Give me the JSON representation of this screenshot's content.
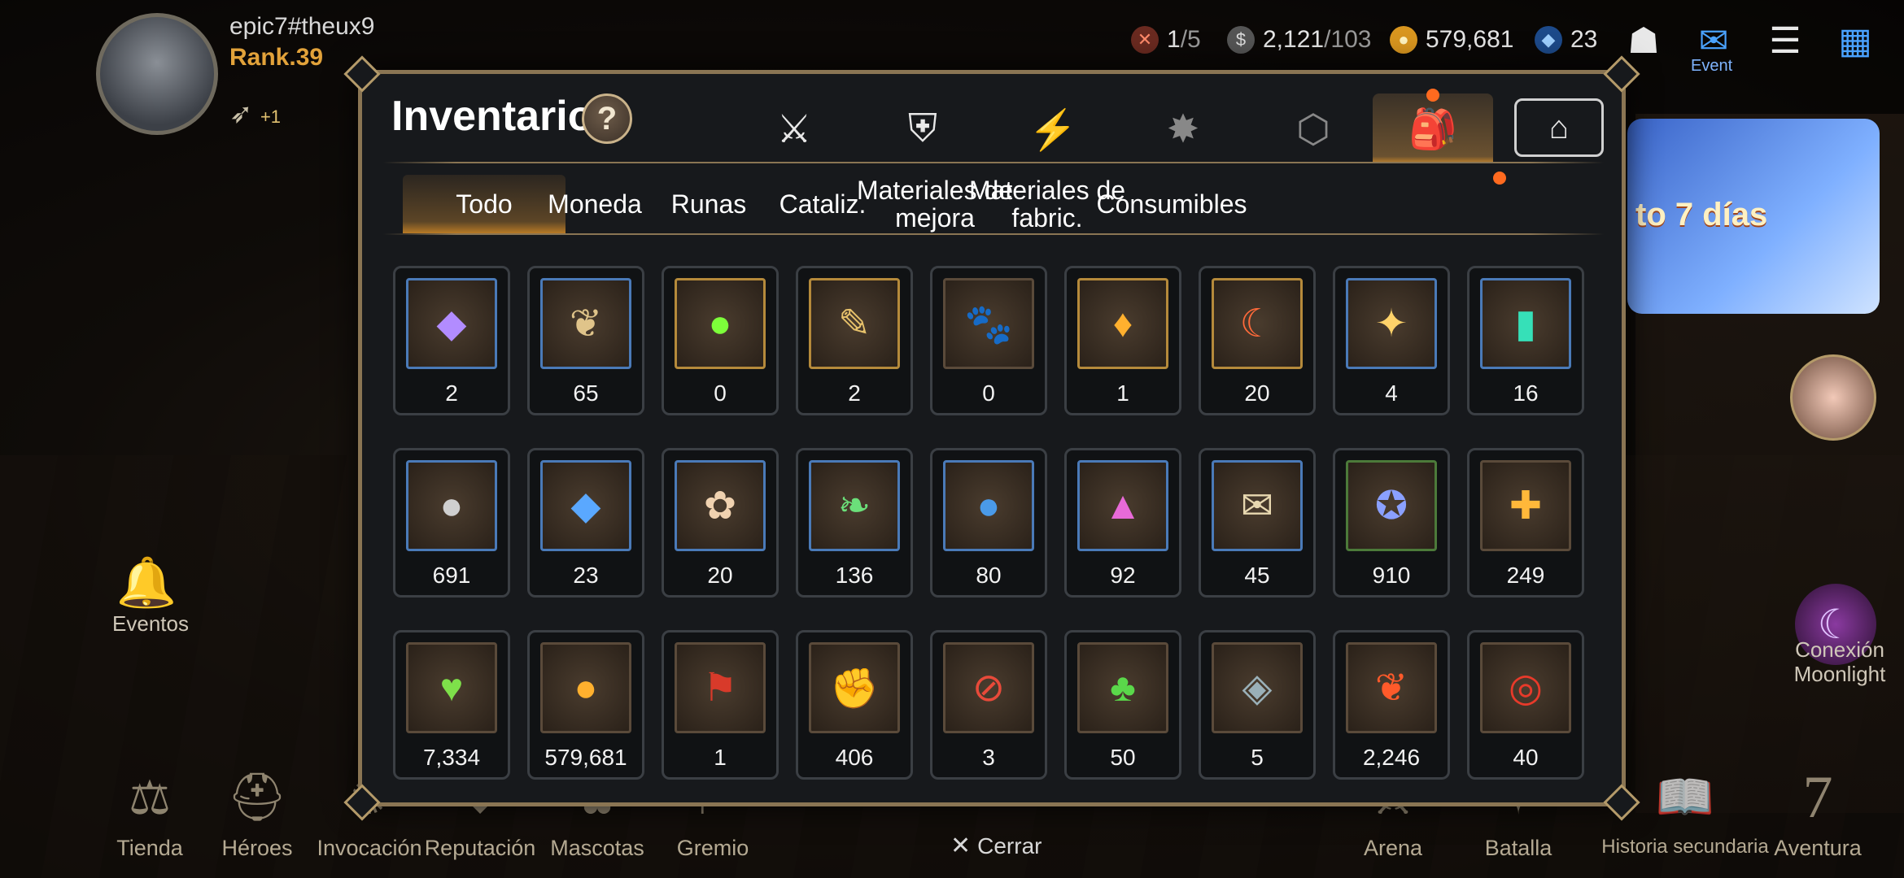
{
  "profile": {
    "username": "epic7#theux9",
    "rank": "Rank.39",
    "wing_badge": "+1"
  },
  "resources": [
    {
      "name": "stamina",
      "icon": "battle-pass-icon",
      "value": "1",
      "max": "/5"
    },
    {
      "name": "energy",
      "icon": "energy-icon",
      "value": "2,121",
      "max": "/103"
    },
    {
      "name": "gold",
      "icon": "gold-coin-icon",
      "value": "579,681",
      "max": ""
    },
    {
      "name": "skystone",
      "icon": "skystone-icon",
      "value": "23",
      "max": ""
    }
  ],
  "top_icons": {
    "event_label": "Event"
  },
  "banner": {
    "text": "to 7 días"
  },
  "side": {
    "events_label": "Eventos",
    "moonlight_label": "Conexión Moonlight"
  },
  "panel": {
    "title": "Inventario",
    "help_symbol": "?",
    "category_tabs": [
      {
        "name": "tab-equipment",
        "icon": "⚔"
      },
      {
        "name": "tab-no-equip",
        "icon": "🛡"
      },
      {
        "name": "tab-skills",
        "icon": "⚡"
      },
      {
        "name": "tab-artifacts",
        "icon": "✸"
      },
      {
        "name": "tab-materials",
        "icon": "⬡"
      },
      {
        "name": "tab-items",
        "icon": "🎒",
        "active": true
      },
      {
        "name": "tab-storage",
        "icon": "⌂"
      }
    ],
    "sub_tabs": [
      "Todo",
      "Moneda",
      "Runas",
      "Cataliz.",
      "Materiales de mejora",
      "Materiales de fabric.",
      "Consumibles"
    ],
    "items": [
      {
        "count": "2",
        "icon": "crystal-icon",
        "glyph": "◆",
        "color": "#b28cff",
        "frame": "blue"
      },
      {
        "count": "65",
        "icon": "herb-icon",
        "glyph": "❦",
        "color": "#e0c48a",
        "frame": "blue"
      },
      {
        "count": "0",
        "icon": "orb-icon",
        "glyph": "●",
        "color": "#7dff3a",
        "frame": "gold"
      },
      {
        "count": "2",
        "icon": "wand-icon",
        "glyph": "✎",
        "color": "#e7c26b",
        "frame": "gold"
      },
      {
        "count": "0",
        "icon": "pet-food-icon",
        "glyph": "🐾",
        "color": "#ffffff",
        "frame": "none"
      },
      {
        "count": "1",
        "icon": "flame-crystal-icon",
        "glyph": "♦",
        "color": "#ffb02e",
        "frame": "gold"
      },
      {
        "count": "20",
        "icon": "horn-icon",
        "glyph": "☾",
        "color": "#ff6a3a",
        "frame": "gold"
      },
      {
        "count": "4",
        "icon": "star-pendant-icon",
        "glyph": "✦",
        "color": "#ffd36a",
        "frame": "blue"
      },
      {
        "count": "16",
        "icon": "emerald-icon",
        "glyph": "▮",
        "color": "#36e0b8",
        "frame": "blue"
      },
      {
        "count": "691",
        "icon": "silver-coin-icon",
        "glyph": "●",
        "color": "#cfcfcf",
        "frame": "blue"
      },
      {
        "count": "23",
        "icon": "skystone-icon",
        "glyph": "◆",
        "color": "#5aa8ff",
        "frame": "blue"
      },
      {
        "count": "20",
        "icon": "gingerbread-icon",
        "glyph": "✿",
        "color": "#f0d2b0",
        "frame": "blue"
      },
      {
        "count": "136",
        "icon": "leaf-icon",
        "glyph": "❧",
        "color": "#6be07a",
        "frame": "blue"
      },
      {
        "count": "80",
        "icon": "blue-orb-icon",
        "glyph": "●",
        "color": "#4a9ae8",
        "frame": "blue"
      },
      {
        "count": "92",
        "icon": "mountain-crystal-icon",
        "glyph": "▲",
        "color": "#e86ad8",
        "frame": "blue"
      },
      {
        "count": "45",
        "icon": "scroll-icon",
        "glyph": "✉",
        "color": "#e8d8b0",
        "frame": "blue"
      },
      {
        "count": "910",
        "icon": "guild-emblem-icon",
        "glyph": "✪",
        "color": "#8aa0ff",
        "frame": "green"
      },
      {
        "count": "249",
        "icon": "gold-emblem-icon",
        "glyph": "✚",
        "color": "#ffb83a",
        "frame": "none"
      },
      {
        "count": "7,334",
        "icon": "heart-icon",
        "glyph": "♥",
        "color": "#7ee04a",
        "frame": "none"
      },
      {
        "count": "579,681",
        "icon": "gold-coin-icon",
        "glyph": "●",
        "color": "#ffb02e",
        "frame": "none"
      },
      {
        "count": "1",
        "icon": "banner-icon",
        "glyph": "⚑",
        "color": "#d83a2a",
        "frame": "none"
      },
      {
        "count": "406",
        "icon": "fist-emblem-icon",
        "glyph": "✊",
        "color": "#f0a83a",
        "frame": "none"
      },
      {
        "count": "3",
        "icon": "no-sign-badge-icon",
        "glyph": "⊘",
        "color": "#e84a3a",
        "frame": "none"
      },
      {
        "count": "50",
        "icon": "clover-icon",
        "glyph": "♣",
        "color": "#5ad84a",
        "frame": "none"
      },
      {
        "count": "5",
        "icon": "stone-box-icon",
        "glyph": "◈",
        "color": "#9ab0b8",
        "frame": "none"
      },
      {
        "count": "2,246",
        "icon": "red-leaf-icon",
        "glyph": "❦",
        "color": "#ff5a2a",
        "frame": "none"
      },
      {
        "count": "40",
        "icon": "bracelet-icon",
        "glyph": "◎",
        "color": "#e83a2a",
        "frame": "none"
      }
    ]
  },
  "bottom_nav": [
    "Tienda",
    "Héroes",
    "Invocación",
    "Reputación",
    "Mascotas",
    "Gremio",
    "Arena",
    "Batalla",
    "Historia secundaria",
    "Aventura"
  ],
  "close_label": "Cerrar"
}
